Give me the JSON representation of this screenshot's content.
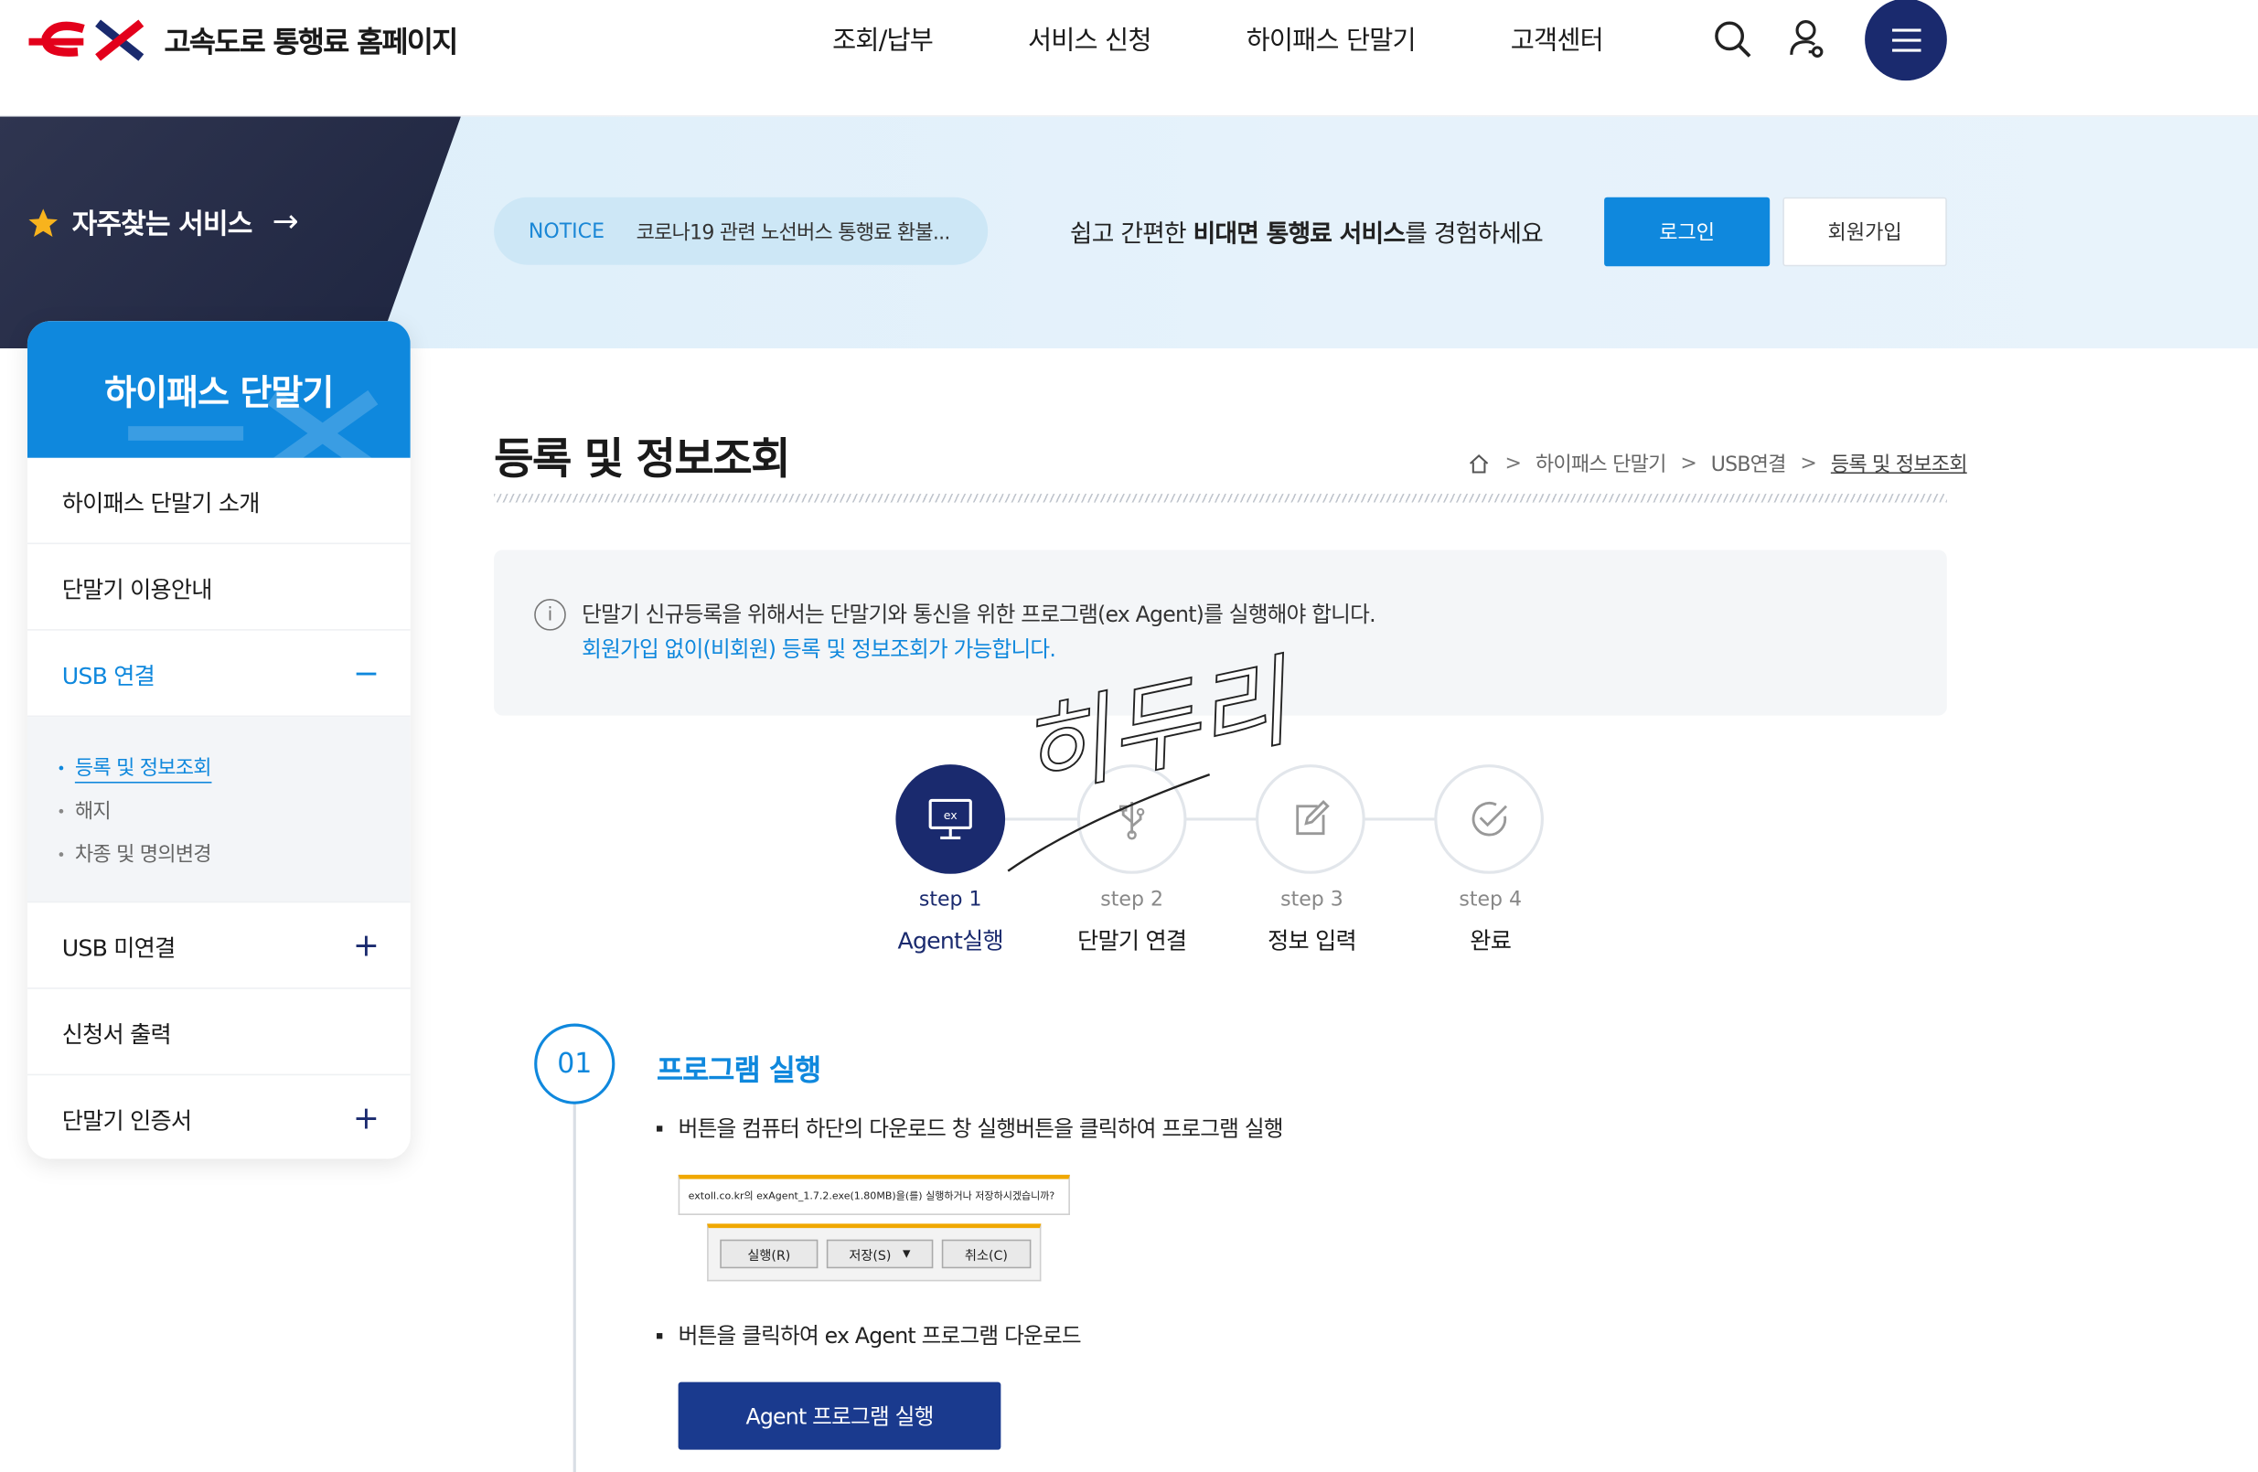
{
  "header": {
    "site_title": "고속도로 통행료 홈페이지",
    "nav": [
      "조회/납부",
      "서비스 신청",
      "하이패스 단말기",
      "고객센터"
    ]
  },
  "band": {
    "favorites_label": "자주찾는 서비스",
    "notice_tag": "NOTICE",
    "notice_text": "코로나19 관련 노선버스 통행료 환불...",
    "promo_pre": "쉽고 간편한 ",
    "promo_bold": "비대면 통행료 서비스",
    "promo_post": "를 경험하세요",
    "login_label": "로그인",
    "join_label": "회원가입"
  },
  "sidebar": {
    "title": "하이패스 단말기",
    "items": [
      {
        "label": "하이패스 단말기 소개",
        "sign": ""
      },
      {
        "label": "단말기 이용안내",
        "sign": ""
      },
      {
        "label": "USB 연결",
        "sign": "−"
      },
      {
        "label": "USB 미연결",
        "sign": "+"
      },
      {
        "label": "신청서 출력",
        "sign": ""
      },
      {
        "label": "단말기 인증서",
        "sign": "+"
      }
    ],
    "sub_items": [
      "등록 및 정보조회",
      "해지",
      "차종 및 명의변경"
    ]
  },
  "main": {
    "title": "등록 및 정보조회",
    "breadcrumb": [
      "하이패스 단말기",
      "USB연결",
      "등록 및 정보조회"
    ],
    "info_line1": "단말기 신규등록을 위해서는 단말기와 통신을 위한 프로그램(ex Agent)를 실행해야 합니다.",
    "info_line2": "회원가입 없이(비회원) 등록 및 정보조회가 가능합니다.",
    "steps": [
      {
        "num": "step 1",
        "name": "Agent실행"
      },
      {
        "num": "step 2",
        "name": "단말기 연결"
      },
      {
        "num": "step 3",
        "name": "정보 입력"
      },
      {
        "num": "step 4",
        "name": "완료"
      }
    ],
    "section_num": "01",
    "section_title": "프로그램 실행",
    "bullet1": "버튼을 컴퓨터 하단의 다운로드 창 실행버튼을 클릭하여 프로그램 실행",
    "download_prompt": "extoll.co.kr의 exAgent_1.7.2.exe(1.80MB)을(를) 실행하거나 저장하시겠습니까?",
    "dl_run": "실행(R)",
    "dl_save": "저장(S)",
    "dl_cancel": "취소(C)",
    "bullet2": "버튼을 클릭하여 ex Agent 프로그램 다운로드",
    "agent_button": "Agent 프로그램 실행"
  },
  "watermark_text": "히두리"
}
